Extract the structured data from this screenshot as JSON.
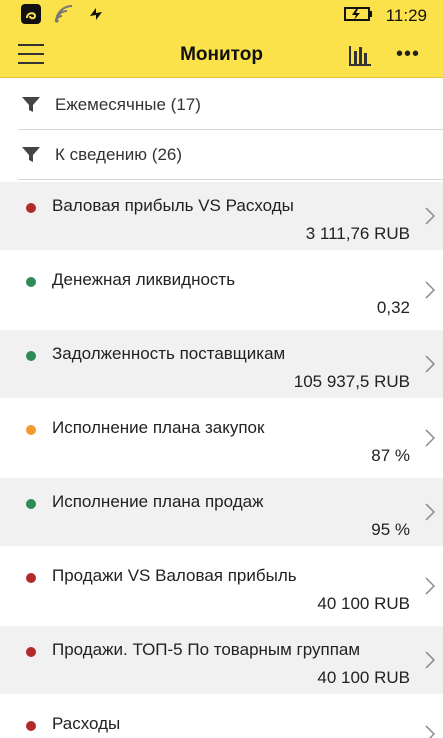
{
  "status_bar": {
    "time": "11:29",
    "icons": [
      "app-notification-icon",
      "wifi-signal-icon",
      "sync-icon",
      "battery-charging-icon"
    ]
  },
  "app_bar": {
    "title": "Монитор",
    "menu_icon": "hamburger-icon",
    "chart_icon": "bar-chart-icon",
    "more_label": "•••"
  },
  "filters": [
    {
      "label": "Ежемесячные (17)",
      "icon": "filter-icon"
    },
    {
      "label": "К сведению (26)",
      "icon": "filter-icon"
    }
  ],
  "colors": {
    "accent": "#fbe24a",
    "status_red": "#b32a2a",
    "status_green": "#2e8b57",
    "status_orange": "#f29a2e"
  },
  "indicators": [
    {
      "name": "Валовая прибыль VS Расходы",
      "value": "3 111,76 RUB",
      "status": "red"
    },
    {
      "name": "Денежная ликвидность",
      "value": "0,32",
      "status": "green"
    },
    {
      "name": "Задолженность поставщикам",
      "value": "105 937,5 RUB",
      "status": "green"
    },
    {
      "name": "Исполнение плана закупок",
      "value": "87 %",
      "status": "orange"
    },
    {
      "name": "Исполнение плана продаж",
      "value": "95 %",
      "status": "green"
    },
    {
      "name": "Продажи VS Валовая прибыль",
      "value": "40 100 RUB",
      "status": "red"
    },
    {
      "name": "Продажи. ТОП-5 По товарным группам",
      "value": "40 100 RUB",
      "status": "red"
    },
    {
      "name": "Расходы",
      "value": "",
      "status": "red"
    }
  ]
}
